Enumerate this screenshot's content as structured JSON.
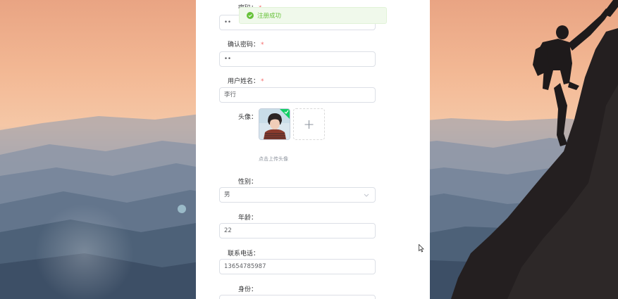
{
  "toast": {
    "message": "注册成功",
    "icon": "check-circle-icon",
    "color": "#67c23a"
  },
  "form": {
    "password": {
      "label": "密码：",
      "value": "••"
    },
    "confirm_password": {
      "label": "确认密码：",
      "value": "••"
    },
    "user_name": {
      "label": "用户姓名：",
      "value": "李行"
    },
    "avatar": {
      "label": "头像：",
      "upload_hint": "点击上传头像",
      "add_icon": "plus-icon",
      "uploaded_badge": "check-icon"
    },
    "gender": {
      "label": "性别：",
      "value": "男",
      "icon": "chevron-down-icon"
    },
    "age": {
      "label": "年龄：",
      "value": "22"
    },
    "phone": {
      "label": "联系电话：",
      "value": "13654785987"
    },
    "identity": {
      "label": "身份："
    },
    "required_mark": "*"
  },
  "colors": {
    "sky_top": "#f2b48c",
    "required": "#f56c6c",
    "success": "#67c23a"
  }
}
